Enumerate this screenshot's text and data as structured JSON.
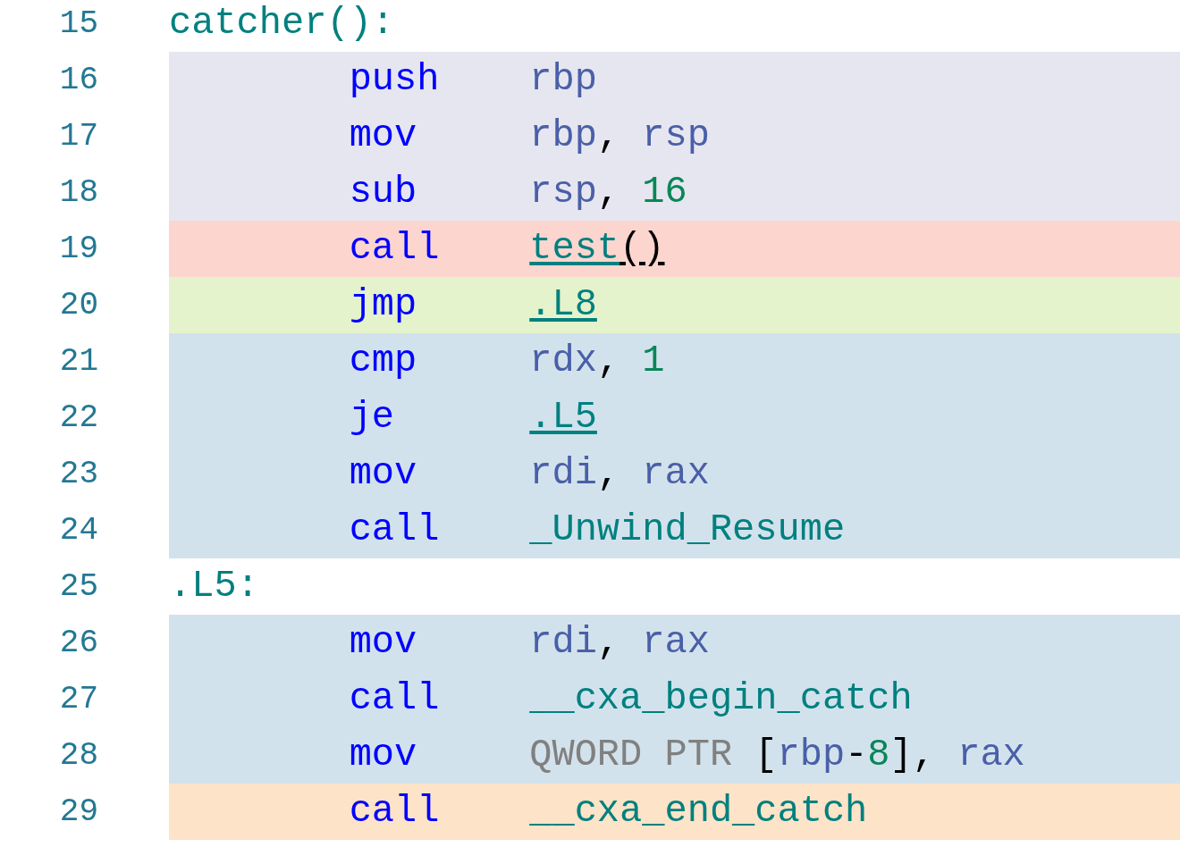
{
  "lines": [
    {
      "number": "15",
      "kind": "label",
      "color": "#ffffff",
      "tokens": [
        {
          "kind": "symbol",
          "text": "catcher():"
        }
      ]
    },
    {
      "number": "16",
      "kind": "instruction",
      "color": "#e6e6f0",
      "mnemonic": "push",
      "tokens": [
        {
          "kind": "register",
          "text": "rbp"
        }
      ]
    },
    {
      "number": "17",
      "kind": "instruction",
      "color": "#e6e6f0",
      "mnemonic": "mov",
      "tokens": [
        {
          "kind": "register",
          "text": "rbp"
        },
        {
          "kind": "punct",
          "text": ", "
        },
        {
          "kind": "register",
          "text": "rsp"
        }
      ]
    },
    {
      "number": "18",
      "kind": "instruction",
      "color": "#e6e6f0",
      "mnemonic": "sub",
      "tokens": [
        {
          "kind": "register",
          "text": "rsp"
        },
        {
          "kind": "punct",
          "text": ", "
        },
        {
          "kind": "number",
          "text": "16"
        }
      ]
    },
    {
      "number": "19",
      "kind": "instruction",
      "color": "#fdd5cf",
      "mnemonic": "call",
      "tokens": [
        {
          "kind": "link",
          "text": "test"
        },
        {
          "kind": "link-punct",
          "text": "()"
        }
      ]
    },
    {
      "number": "20",
      "kind": "instruction",
      "color": "#e4f3cb",
      "mnemonic": "jmp",
      "tokens": [
        {
          "kind": "link",
          "text": ".L8"
        }
      ]
    },
    {
      "number": "21",
      "kind": "instruction",
      "color": "#d2e2ec",
      "mnemonic": "cmp",
      "tokens": [
        {
          "kind": "register",
          "text": "rdx"
        },
        {
          "kind": "punct",
          "text": ", "
        },
        {
          "kind": "number",
          "text": "1"
        }
      ]
    },
    {
      "number": "22",
      "kind": "instruction",
      "color": "#d2e2ec",
      "mnemonic": "je",
      "tokens": [
        {
          "kind": "link",
          "text": ".L5"
        }
      ]
    },
    {
      "number": "23",
      "kind": "instruction",
      "color": "#d2e2ec",
      "mnemonic": "mov",
      "tokens": [
        {
          "kind": "register",
          "text": "rdi"
        },
        {
          "kind": "punct",
          "text": ", "
        },
        {
          "kind": "register",
          "text": "rax"
        }
      ]
    },
    {
      "number": "24",
      "kind": "instruction",
      "color": "#d2e2ec",
      "mnemonic": "call",
      "tokens": [
        {
          "kind": "symbol",
          "text": "_Unwind_Resume"
        }
      ]
    },
    {
      "number": "25",
      "kind": "label",
      "color": "#ffffff",
      "tokens": [
        {
          "kind": "symbol",
          "text": ".L5:"
        }
      ]
    },
    {
      "number": "26",
      "kind": "instruction",
      "color": "#d2e2ec",
      "mnemonic": "mov",
      "tokens": [
        {
          "kind": "register",
          "text": "rdi"
        },
        {
          "kind": "punct",
          "text": ", "
        },
        {
          "kind": "register",
          "text": "rax"
        }
      ]
    },
    {
      "number": "27",
      "kind": "instruction",
      "color": "#d2e2ec",
      "mnemonic": "call",
      "tokens": [
        {
          "kind": "symbol",
          "text": "__cxa_begin_catch"
        }
      ]
    },
    {
      "number": "28",
      "kind": "instruction",
      "color": "#d2e2ec",
      "mnemonic": "mov",
      "tokens": [
        {
          "kind": "keyword",
          "text": "QWORD PTR"
        },
        {
          "kind": "punct",
          "text": " ["
        },
        {
          "kind": "register",
          "text": "rbp"
        },
        {
          "kind": "punct",
          "text": "-"
        },
        {
          "kind": "number",
          "text": "8"
        },
        {
          "kind": "punct",
          "text": "], "
        },
        {
          "kind": "register",
          "text": "rax"
        }
      ]
    },
    {
      "number": "29",
      "kind": "instruction",
      "color": "#fde3c7",
      "mnemonic": "call",
      "tokens": [
        {
          "kind": "symbol",
          "text": "__cxa_end_catch"
        }
      ]
    }
  ]
}
